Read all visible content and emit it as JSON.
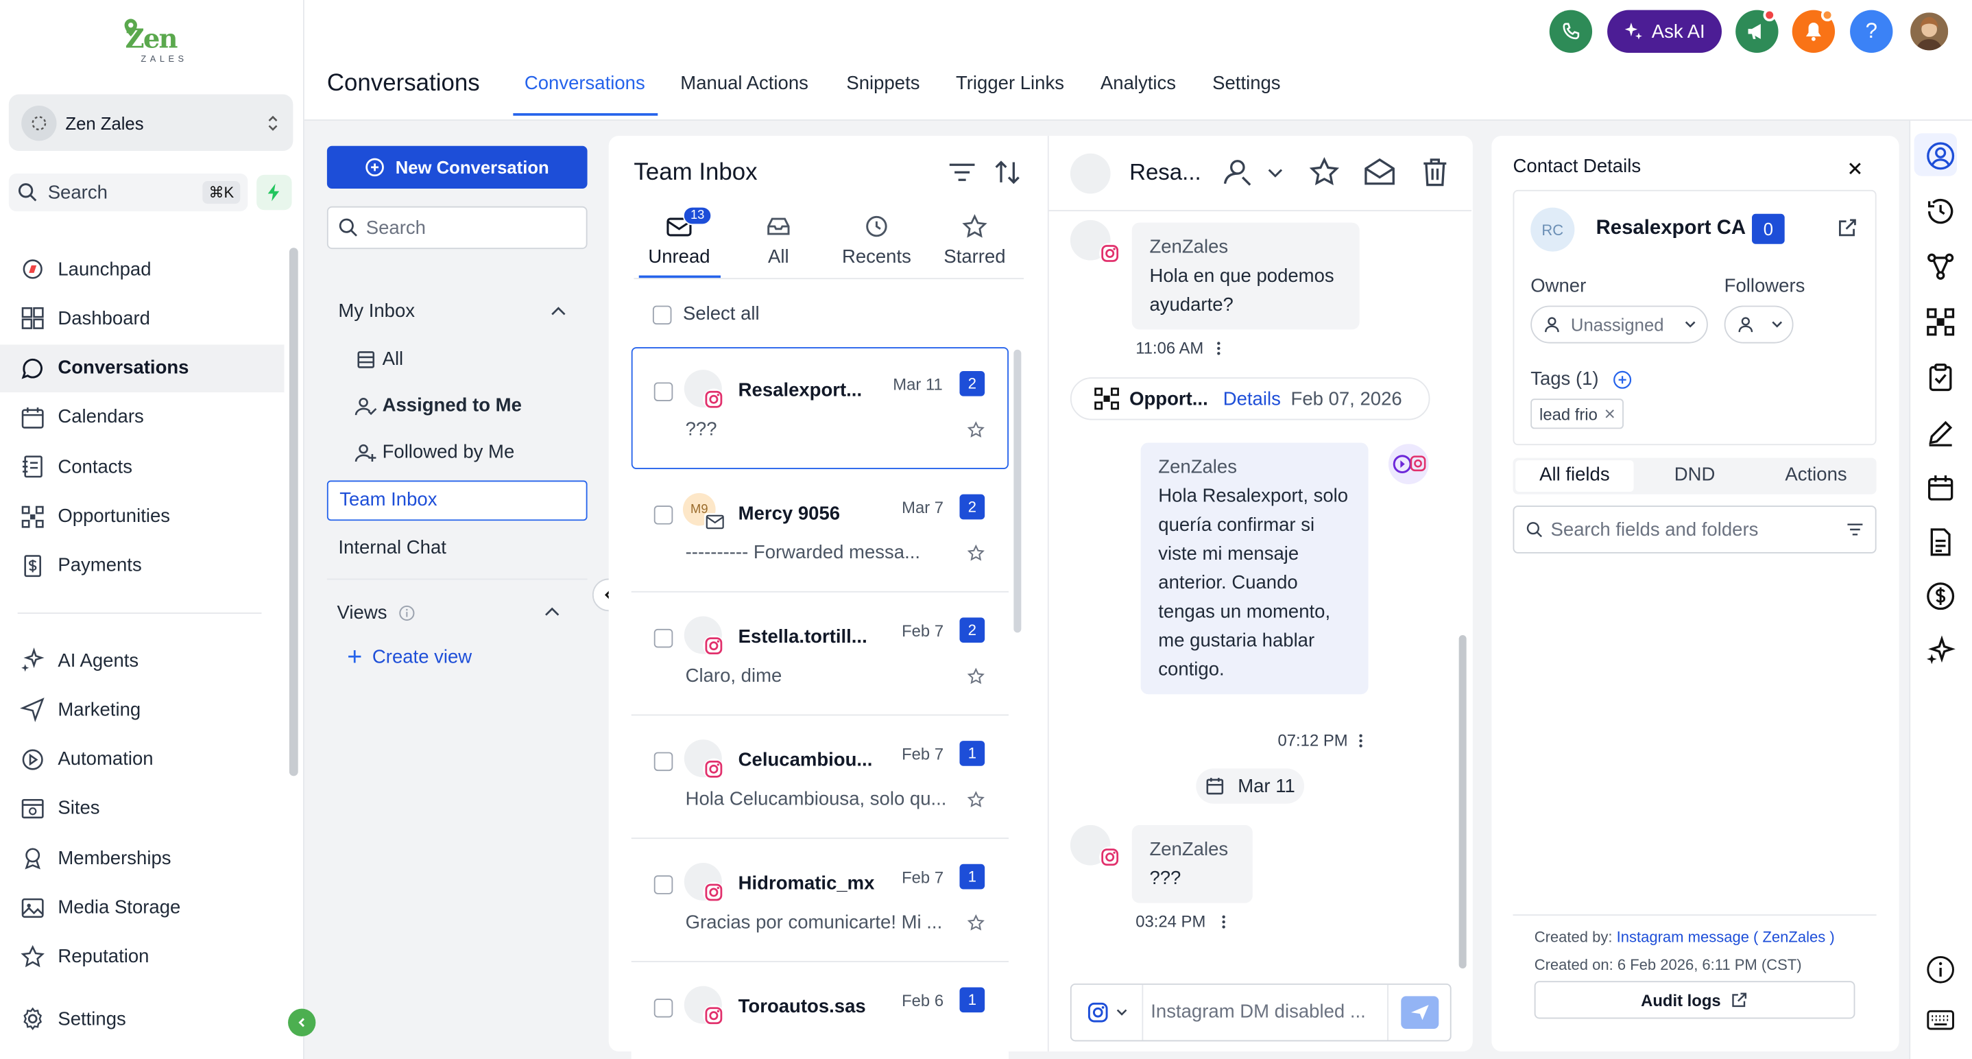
{
  "brand": {
    "logo_top": "Zen",
    "logo_bottom": "ZALES"
  },
  "sidebar": {
    "account_name": "Zen Zales",
    "search_placeholder": "Search",
    "search_shortcut": "⌘K",
    "items": [
      {
        "label": "Launchpad",
        "icon": "launchpad-icon"
      },
      {
        "label": "Dashboard",
        "icon": "dashboard-icon"
      },
      {
        "label": "Conversations",
        "icon": "chat-icon",
        "active": true
      },
      {
        "label": "Calendars",
        "icon": "calendar-icon"
      },
      {
        "label": "Contacts",
        "icon": "contacts-icon"
      },
      {
        "label": "Opportunities",
        "icon": "opportunities-icon"
      },
      {
        "label": "Payments",
        "icon": "payments-icon"
      }
    ],
    "items2": [
      {
        "label": "AI Agents",
        "icon": "ai-agents-icon"
      },
      {
        "label": "Marketing",
        "icon": "send-icon"
      },
      {
        "label": "Automation",
        "icon": "automation-icon"
      },
      {
        "label": "Sites",
        "icon": "sites-icon"
      },
      {
        "label": "Memberships",
        "icon": "memberships-icon"
      },
      {
        "label": "Media Storage",
        "icon": "image-icon"
      },
      {
        "label": "Reputation",
        "icon": "star-icon"
      }
    ],
    "settings_label": "Settings"
  },
  "topbar": {
    "page_title": "Conversations",
    "tabs": [
      "Conversations",
      "Manual Actions",
      "Snippets",
      "Trigger Links",
      "Analytics",
      "Settings"
    ],
    "active_tab": "Conversations",
    "ask_ai": "Ask AI",
    "help": "?"
  },
  "left_panel": {
    "new_conversation": "New Conversation",
    "search_placeholder": "Search",
    "my_inbox": "My Inbox",
    "inbox_items": [
      "All",
      "Assigned to Me",
      "Followed by Me"
    ],
    "team_inbox": "Team Inbox",
    "internal_chat": "Internal Chat",
    "views": "Views",
    "create_view": "Create view"
  },
  "inbox": {
    "title": "Team Inbox",
    "tabs": [
      {
        "label": "Unread",
        "count": "13"
      },
      {
        "label": "All"
      },
      {
        "label": "Recents"
      },
      {
        "label": "Starred"
      }
    ],
    "select_all": "Select all",
    "conversations": [
      {
        "name": "Resalexport...",
        "date": "Mar 11",
        "badge": "2",
        "preview": "???",
        "channel": "instagram"
      },
      {
        "name": "Mercy 9056",
        "date": "Mar 7",
        "badge": "2",
        "preview": "---------- Forwarded messa...",
        "channel": "email",
        "initials": "M9"
      },
      {
        "name": "Estella.tortill...",
        "date": "Feb 7",
        "badge": "2",
        "preview": "Claro, dime",
        "channel": "instagram"
      },
      {
        "name": "Celucambiou...",
        "date": "Feb 7",
        "badge": "1",
        "preview": "Hola Celucambiousa, solo qu...",
        "channel": "instagram"
      },
      {
        "name": "Hidromatic_mx",
        "date": "Feb 7",
        "badge": "1",
        "preview": "Gracias por comunicarte! Mi ...",
        "channel": "instagram"
      },
      {
        "name": "Toroautos.sas",
        "date": "Feb 6",
        "badge": "1",
        "preview": "",
        "channel": "instagram"
      }
    ]
  },
  "chat": {
    "contact_short": "Resa...",
    "messages": [
      {
        "sender": "ZenZales",
        "text": "Hola en que podemos ayudarte?",
        "time": "11:06 AM"
      },
      {
        "sender": "ZenZales",
        "text": "Hola Resalexport, solo quería confirmar si viste mi mensaje anterior. Cuando tengas un momento, me gustaria hablar contigo.",
        "time": "07:12 PM"
      },
      {
        "sender": "ZenZales",
        "text": "???",
        "time": "03:24 PM"
      }
    ],
    "opportunity": {
      "label": "Opport...",
      "link": "Details",
      "date": "Feb 07, 2026"
    },
    "date_divider": "Mar 11",
    "composer_placeholder": "Instagram DM disabled ..."
  },
  "contact": {
    "header": "Contact Details",
    "initials": "RC",
    "name": "Resalexport CA",
    "count": "0",
    "owner_label": "Owner",
    "owner_value": "Unassigned",
    "followers_label": "Followers",
    "tags_label": "Tags (1)",
    "tag": "lead frio",
    "tabs": [
      "All fields",
      "DND",
      "Actions"
    ],
    "search_placeholder": "Search fields and folders",
    "created_by_prefix": "Created by:",
    "created_by_value": "Instagram message ( ZenZales )",
    "created_on": "Created on: 6 Feb 2026, 6:11 PM (CST)",
    "audit_logs": "Audit logs"
  },
  "colors": {
    "accent": "#2563eb",
    "brand_green": "#5aa84d",
    "instagram": "#e1306c",
    "ask_ai_bg": "#4c1d95",
    "badge": "#1d4ed8"
  }
}
